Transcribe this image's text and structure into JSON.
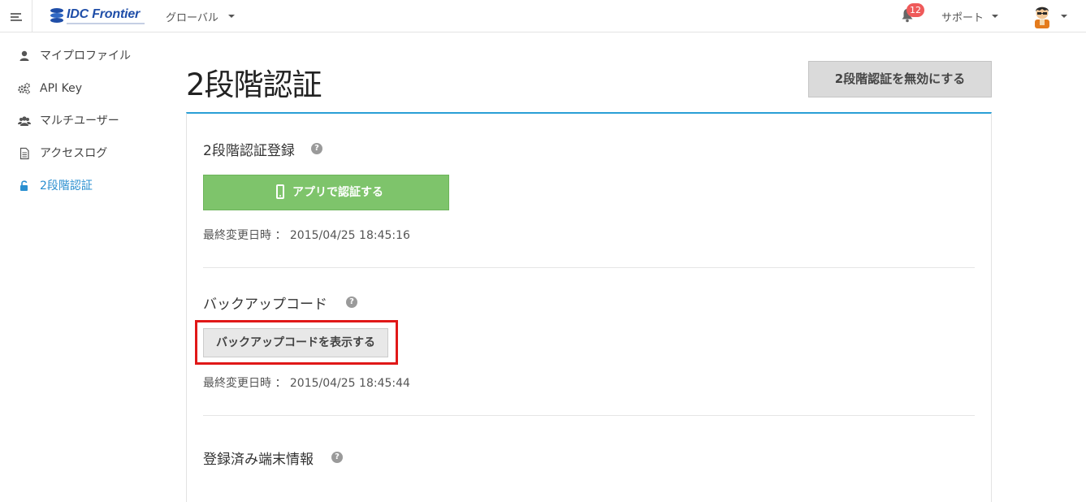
{
  "header": {
    "logo_text": "IDC Frontier",
    "region_label": "グローバル",
    "notification_count": "12",
    "support_label": "サポート"
  },
  "sidebar": {
    "items": [
      {
        "label": "マイプロファイル",
        "icon": "user-icon"
      },
      {
        "label": "API Key",
        "icon": "gears-icon"
      },
      {
        "label": "マルチユーザー",
        "icon": "users-icon"
      },
      {
        "label": "アクセスログ",
        "icon": "document-icon"
      },
      {
        "label": "2段階認証",
        "icon": "unlock-icon",
        "active": true
      }
    ]
  },
  "main": {
    "title": "2段階認証",
    "disable_button": "2段階認証を無効にする",
    "sections": [
      {
        "title": "2段階認証登録",
        "button": "アプリで認証する",
        "last_modified": "最終変更日時 ： 2015/04/25 18:45:16"
      },
      {
        "title": "バックアップコード",
        "button": "バックアップコードを表示する",
        "last_modified": "最終変更日時 ： 2015/04/25 18:45:44"
      },
      {
        "title": "登録済み端末情報"
      }
    ]
  },
  "colors": {
    "accent": "#2a9fd6",
    "primary_button": "#7ec46b",
    "highlight_box": "#e01818",
    "badge": "#ef5a5a"
  }
}
